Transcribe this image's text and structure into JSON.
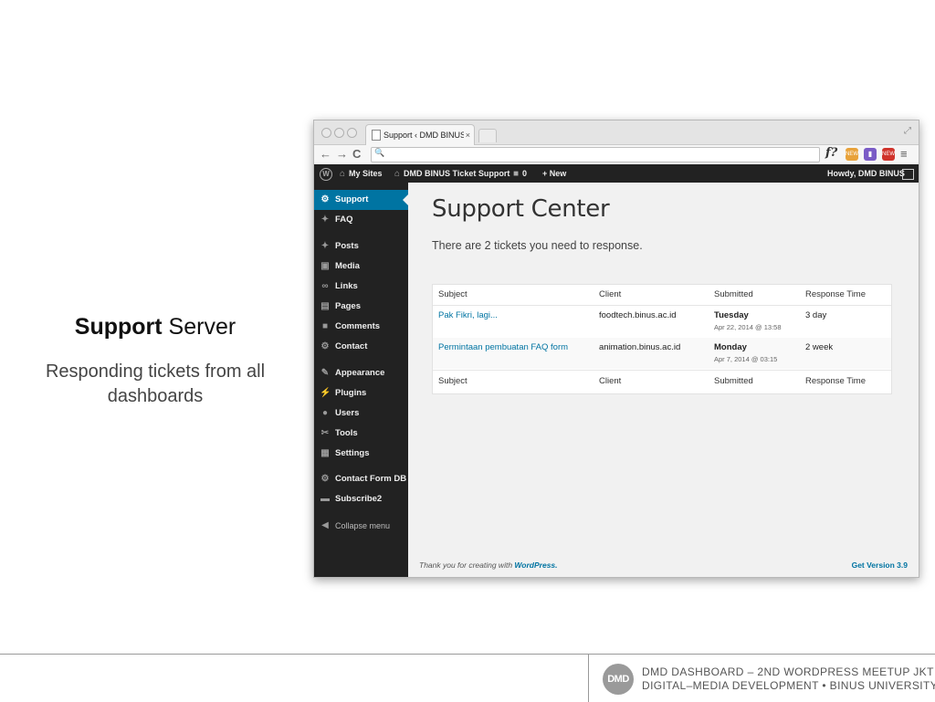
{
  "slide": {
    "title_bold": "Support",
    "title_rest": " Server",
    "subtitle": "Responding tickets from all dashboards"
  },
  "browser": {
    "tab_title": "Support ‹ DMD BINUS Ticke",
    "tab_close": "×",
    "back": "←",
    "forward": "→",
    "reload": "C",
    "search_icon": "🔍",
    "ext_label": "f?",
    "ext_new_label": "NEW",
    "menu": "≡"
  },
  "adminbar": {
    "wp_logo": "W",
    "my_sites": "My Sites",
    "site_name": "DMD BINUS Ticket Support",
    "comments_count": "0",
    "new_label": "+ New",
    "howdy": "Howdy, DMD BINUS"
  },
  "sidebar": {
    "items": [
      {
        "label": "Support",
        "icon": "gear-icon",
        "glyph": "⚙"
      },
      {
        "label": "FAQ",
        "icon": "pin-icon",
        "glyph": "✦"
      },
      {
        "label": "Posts",
        "icon": "pin-icon",
        "glyph": "✦"
      },
      {
        "label": "Media",
        "icon": "media-icon",
        "glyph": "▣"
      },
      {
        "label": "Links",
        "icon": "link-icon",
        "glyph": "∞"
      },
      {
        "label": "Pages",
        "icon": "pages-icon",
        "glyph": "▤"
      },
      {
        "label": "Comments",
        "icon": "comment-icon",
        "glyph": "■"
      },
      {
        "label": "Contact",
        "icon": "gear-icon",
        "glyph": "⚙"
      },
      {
        "label": "Appearance",
        "icon": "brush-icon",
        "glyph": "✎"
      },
      {
        "label": "Plugins",
        "icon": "plug-icon",
        "glyph": "⚡"
      },
      {
        "label": "Users",
        "icon": "user-icon",
        "glyph": "●"
      },
      {
        "label": "Tools",
        "icon": "wrench-icon",
        "glyph": "✂"
      },
      {
        "label": "Settings",
        "icon": "settings-icon",
        "glyph": "▦"
      },
      {
        "label": "Contact Form DB",
        "icon": "gear-icon",
        "glyph": "⚙"
      },
      {
        "label": "Subscribe2",
        "icon": "mail-icon",
        "glyph": "▬"
      },
      {
        "label": "Collapse menu",
        "icon": "collapse-icon",
        "glyph": "◀"
      }
    ]
  },
  "content": {
    "heading": "Support Center",
    "notice": "There are 2 tickets you need to response.",
    "columns": [
      "Subject",
      "Client",
      "Submitted",
      "Response Time"
    ],
    "rows": [
      {
        "subject": "Pak Fikri, lagi...",
        "client": "foodtech.binus.ac.id",
        "day": "Tuesday",
        "date": "Apr 22, 2014 @ 13:58",
        "response": "3 day"
      },
      {
        "subject": "Permintaan pembuatan FAQ form",
        "client": "animation.binus.ac.id",
        "day": "Monday",
        "date": "Apr 7, 2014 @ 03:15",
        "response": "2 week"
      }
    ]
  },
  "wp_footer": {
    "thanks": "Thank you for creating with ",
    "wordpress": "WordPress.",
    "version": "Get Version 3.9"
  },
  "bottom_bar": {
    "logo": "DMD",
    "line1": "DMD Dashboard – 2nd WordPress Meetup JKT",
    "line2": "Digital–Media Development • Binus University"
  }
}
